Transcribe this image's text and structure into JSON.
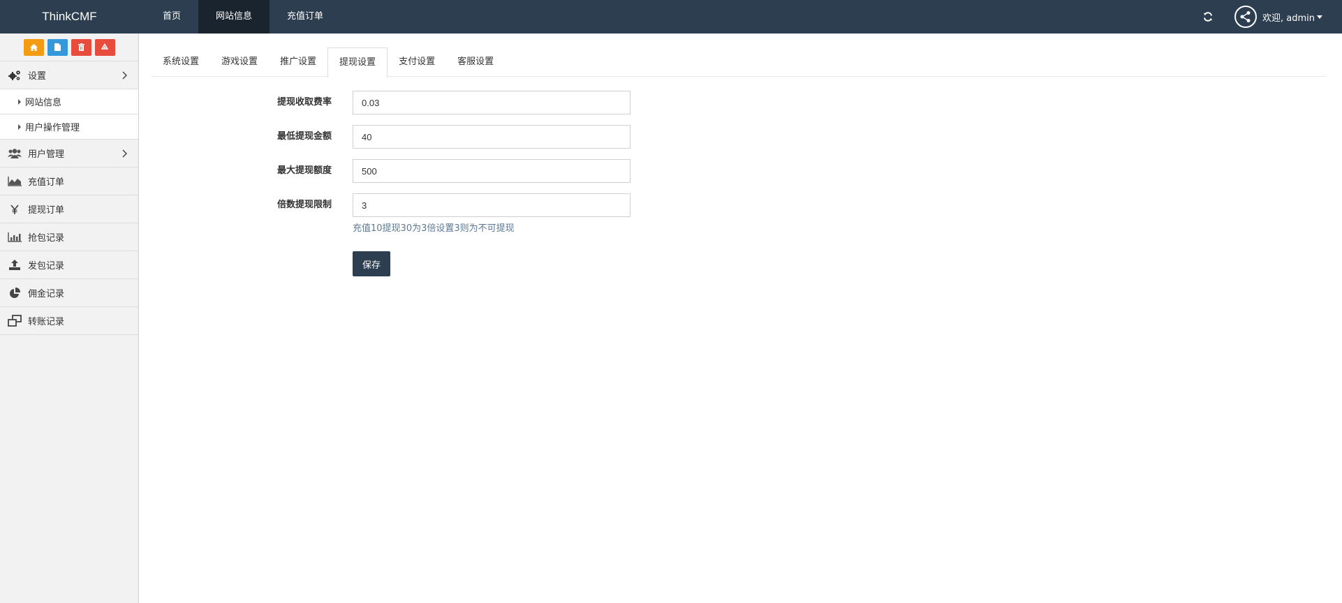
{
  "brand": "ThinkCMF",
  "topnav": [
    {
      "label": "首页"
    },
    {
      "label": "网站信息"
    },
    {
      "label": "充值订单"
    }
  ],
  "user": {
    "welcome": "欢迎, admin"
  },
  "sidebar": {
    "shortcuts": [
      {
        "icon": "home-icon",
        "color": "#f39c12"
      },
      {
        "icon": "document-icon",
        "color": "#3498db"
      },
      {
        "icon": "trash-icon",
        "color": "#e74c3c"
      },
      {
        "icon": "recycle-icon",
        "color": "#e74c3c"
      }
    ],
    "items": [
      {
        "label": "设置",
        "icon": "gears-icon"
      },
      {
        "label": "网站信息"
      },
      {
        "label": "用户操作管理"
      },
      {
        "label": "用户管理",
        "icon": "users-icon"
      },
      {
        "label": "充值订单",
        "icon": "area-chart-icon"
      },
      {
        "label": "提现订单",
        "icon": "yen-icon"
      },
      {
        "label": "抢包记录",
        "icon": "bar-chart-icon"
      },
      {
        "label": "发包记录",
        "icon": "upload-icon"
      },
      {
        "label": "佣金记录",
        "icon": "pie-chart-icon"
      },
      {
        "label": "转账记录",
        "icon": "clone-icon"
      }
    ]
  },
  "tabs": [
    {
      "label": "系统设置"
    },
    {
      "label": "游戏设置"
    },
    {
      "label": "推广设置"
    },
    {
      "label": "提现设置"
    },
    {
      "label": "支付设置"
    },
    {
      "label": "客服设置"
    }
  ],
  "form": {
    "fields": [
      {
        "label": "提现收取费率",
        "value": "0.03"
      },
      {
        "label": "最低提现金额",
        "value": "40"
      },
      {
        "label": "最大提现额度",
        "value": "500"
      },
      {
        "label": "倍数提现限制",
        "value": "3"
      }
    ],
    "help": "充值10提现30为3倍设置3则为不可提现",
    "save_label": "保存"
  },
  "colors": {
    "topbar": "#2c3e50",
    "topnav_active": "#1a242f",
    "help_text": "#5b7996"
  }
}
